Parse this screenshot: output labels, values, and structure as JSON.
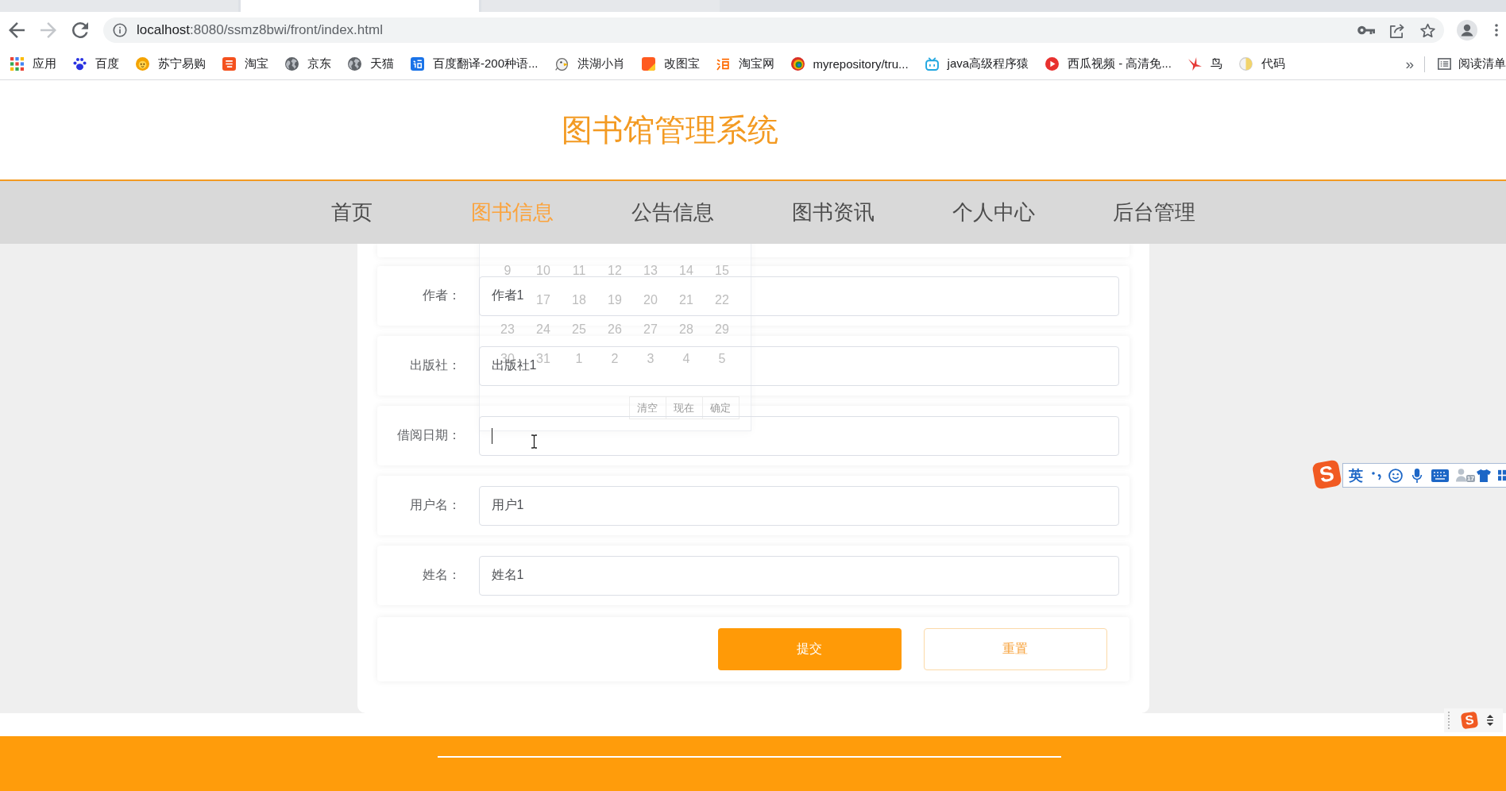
{
  "browser": {
    "tabs": [
      {
        "selected": false
      },
      {
        "selected": true
      },
      {
        "selected": false
      }
    ],
    "nav_buttons": [
      {
        "kind": "back",
        "disabled": false
      },
      {
        "kind": "forward",
        "disabled": true
      },
      {
        "kind": "reload",
        "disabled": false
      }
    ],
    "address": {
      "host": "localhost",
      "path": ":8080/ssmz8bwi/front/index.html"
    },
    "bookmarks": [
      {
        "kind": "apps",
        "label": "应用"
      },
      {
        "kind": "paw",
        "label": "百度"
      },
      {
        "kind": "lion",
        "label": "苏宁易购"
      },
      {
        "kind": "orange-tile",
        "label": "淘宝"
      },
      {
        "kind": "globe",
        "label": "京东"
      },
      {
        "kind": "globe",
        "label": "天猫"
      },
      {
        "kind": "blue-tile",
        "label": "百度翻译-200种语..."
      },
      {
        "kind": "mascot",
        "label": "洪湖小肖"
      },
      {
        "kind": "folder",
        "label": "改图宝"
      },
      {
        "kind": "orange-glyph",
        "label": "淘宝网"
      },
      {
        "kind": "ring",
        "label": "myrepository/tru..."
      },
      {
        "kind": "tv",
        "label": "java高级程序猿"
      },
      {
        "kind": "play",
        "label": "西瓜视频 - 高清免..."
      },
      {
        "kind": "bird",
        "label": "鸟"
      },
      {
        "kind": "moon",
        "label": "代码"
      }
    ],
    "overflow": "»",
    "reading_list": "阅读清单"
  },
  "header": {
    "title": "图书馆管理系统"
  },
  "nav": [
    {
      "label": "首页",
      "selected": false
    },
    {
      "label": "图书信息",
      "selected": true
    },
    {
      "label": "公告信息",
      "selected": false
    },
    {
      "label": "图书资讯",
      "selected": false
    },
    {
      "label": "个人中心",
      "selected": false
    },
    {
      "label": "后台管理",
      "selected": false
    }
  ],
  "form": {
    "fields": [
      {
        "label": "作者：",
        "value": "作者1",
        "focused": false
      },
      {
        "label": "出版社：",
        "value": "出版社1",
        "focused": false
      },
      {
        "label": "借阅日期：",
        "focused": true
      },
      {
        "label": "用户名：",
        "value": "用户1",
        "focused": false
      },
      {
        "label": "姓名：",
        "value": "姓名1",
        "focused": false
      }
    ],
    "buttons": [
      {
        "kind": "primary",
        "label": "提交"
      },
      {
        "kind": "secondary",
        "label": "重置"
      }
    ]
  },
  "date_picker": {
    "weeks": [
      [
        "9",
        "10",
        "11",
        "12",
        "13",
        "14",
        "15"
      ],
      [
        "17",
        "18",
        "19",
        "20",
        "21",
        "22"
      ],
      [
        "23",
        "24",
        "25",
        "26",
        "27",
        "28",
        "29"
      ],
      [
        "30",
        "31",
        "1",
        "2",
        "3",
        "4",
        "5"
      ]
    ],
    "actions": [
      "清空",
      "现在",
      "确定"
    ]
  },
  "ime_toolbar": {
    "logo": "S",
    "mode": "英",
    "badge": "17"
  },
  "ime_mini": {
    "logo": "S"
  }
}
